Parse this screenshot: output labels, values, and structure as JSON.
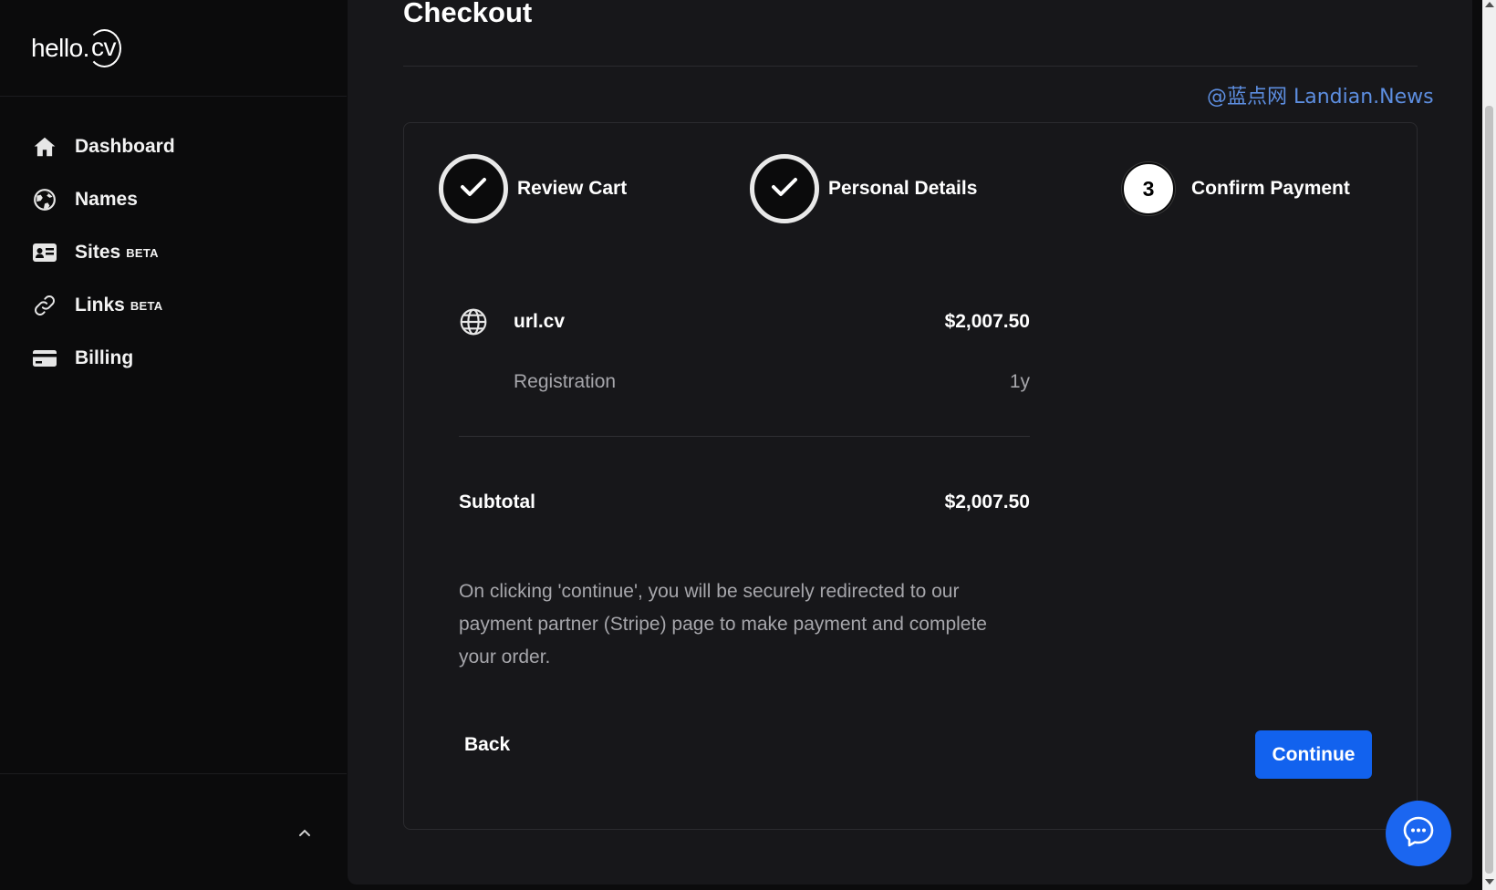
{
  "brand": {
    "logo_text_main": "hello.",
    "logo_text_ring": "cv"
  },
  "sidebar": {
    "items": [
      {
        "label": "Dashboard",
        "icon": "home-icon",
        "badge": ""
      },
      {
        "label": "Names",
        "icon": "globe-icon",
        "badge": ""
      },
      {
        "label": "Sites",
        "icon": "id-card-icon",
        "badge": "BETA"
      },
      {
        "label": "Links",
        "icon": "link-icon",
        "badge": "BETA"
      },
      {
        "label": "Billing",
        "icon": "credit-card-icon",
        "badge": ""
      }
    ],
    "collapse_icon": "chevron-up-icon"
  },
  "main": {
    "title": "Checkout",
    "watermark": "@蓝点网 Landian.News",
    "steps": [
      {
        "label": "Review Cart",
        "state": "done"
      },
      {
        "label": "Personal Details",
        "state": "done"
      },
      {
        "label": "Confirm Payment",
        "state": "current",
        "number": "3"
      }
    ],
    "cart": {
      "item_name": "url.cv",
      "item_price": "$2,007.50",
      "item_icon": "globe-icon",
      "detail_label": "Registration",
      "detail_value": "1y"
    },
    "subtotal": {
      "label": "Subtotal",
      "value": "$2,007.50"
    },
    "note": "On clicking 'continue', you will be securely redirected to our payment partner (Stripe) page to make payment and complete your order.",
    "back_label": "Back",
    "continue_label": "Continue"
  },
  "chat": {
    "icon": "chat-bubble-icon"
  },
  "colors": {
    "accent": "#1262ee",
    "panel": "#17171a",
    "background": "#0b0b0c",
    "muted_text": "#a6a6ab"
  }
}
